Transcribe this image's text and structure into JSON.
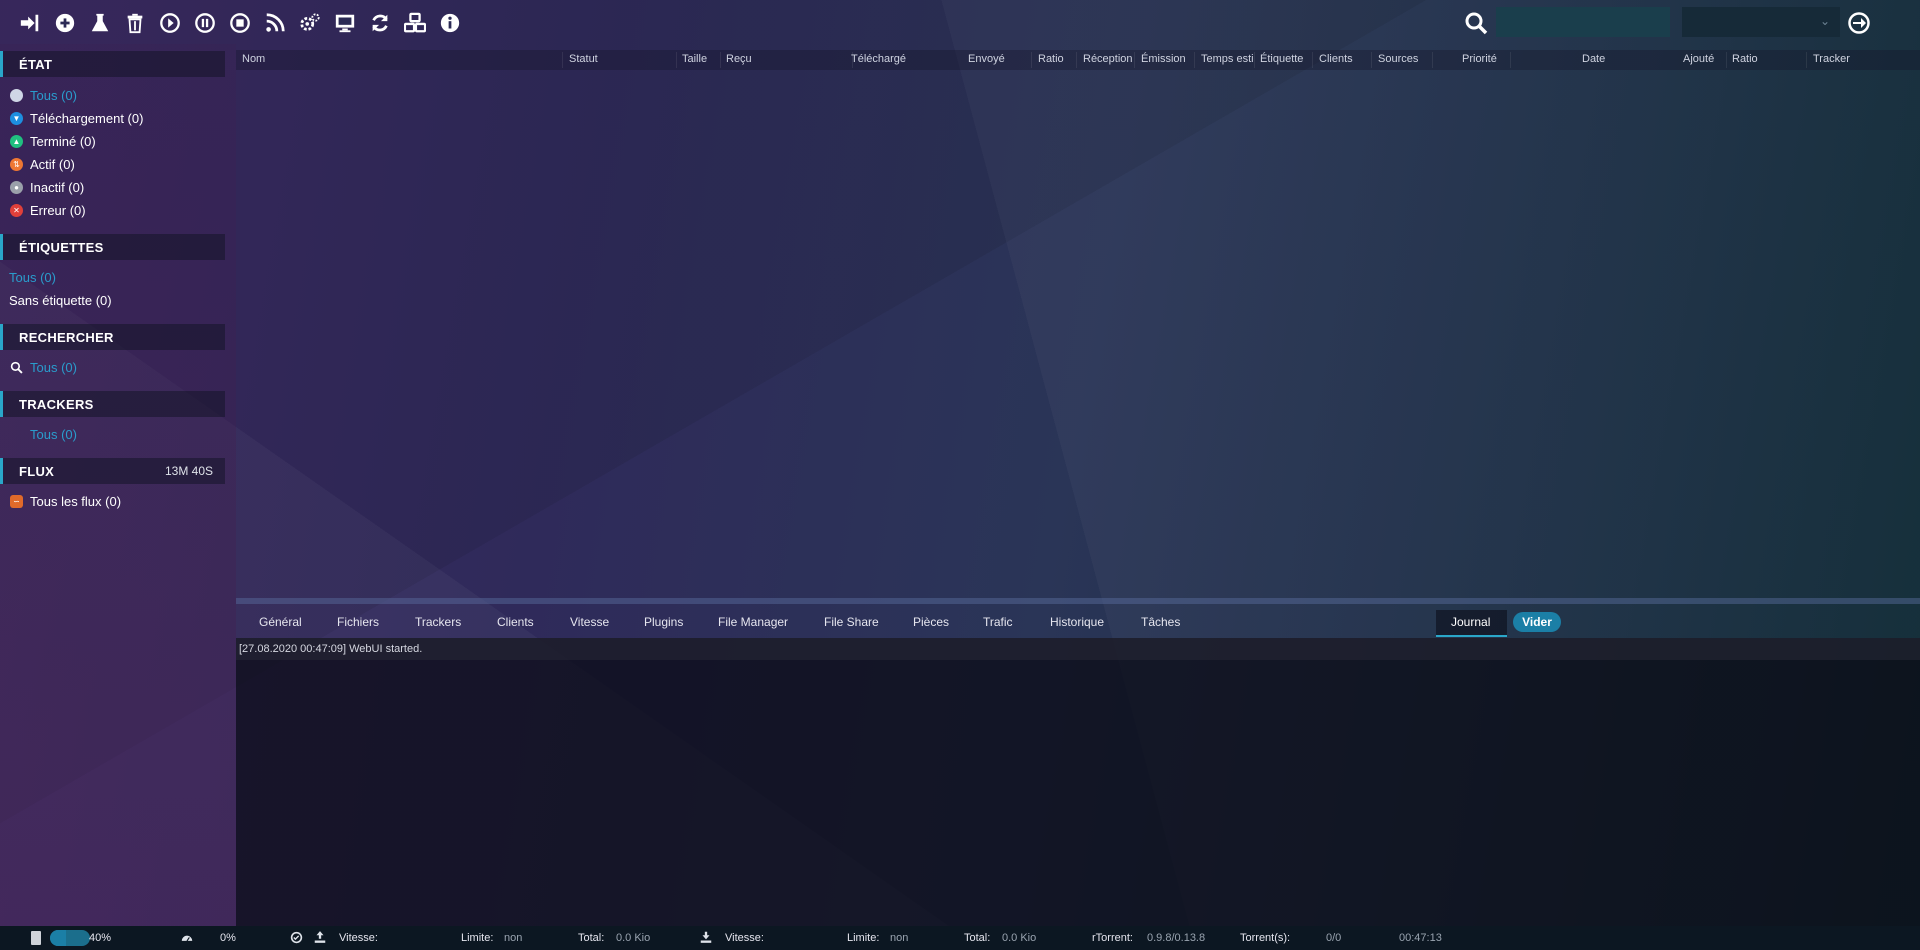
{
  "toolbar": {
    "buttons": [
      "login-icon",
      "add-icon",
      "flask-icon",
      "trash-icon",
      "play-icon",
      "pause-icon",
      "stop-icon",
      "rss-icon",
      "settings-icon",
      "monitor-icon",
      "refresh-icon",
      "plugins-icon",
      "info-icon"
    ],
    "search_placeholder": "",
    "search_select_value": ""
  },
  "sidebar": {
    "state": {
      "title": "ÉTAT",
      "items": [
        {
          "label": "Tous (0)",
          "color": "#cfd6e6"
        },
        {
          "label": "Téléchargement (0)",
          "color": "#1d8fe0"
        },
        {
          "label": "Terminé (0)",
          "color": "#20c080"
        },
        {
          "label": "Actif (0)",
          "color": "#ee7733"
        },
        {
          "label": "Inactif (0)",
          "color": "#9aa0aa"
        },
        {
          "label": "Erreur (0)",
          "color": "#e0403a"
        }
      ]
    },
    "labels": {
      "title": "ÉTIQUETTES",
      "items": [
        "Tous (0)",
        "Sans étiquette (0)"
      ]
    },
    "search": {
      "title": "RECHERCHER",
      "items": [
        "Tous (0)"
      ]
    },
    "trackers": {
      "title": "TRACKERS",
      "items": [
        "Tous (0)"
      ]
    },
    "feeds": {
      "title": "FLUX",
      "timer": "13M 40S",
      "items": [
        "Tous les flux (0)"
      ]
    }
  },
  "table": {
    "columns": [
      "Nom",
      "Statut",
      "Taille",
      "Reçu",
      "Téléchargé",
      "Envoyé",
      "Ratio",
      "Réception",
      "Émission",
      "Temps esti",
      "Étiquette",
      "Clients",
      "Sources",
      "Priorité",
      "Date",
      "Ajouté",
      "Ratio",
      "Tracker"
    ]
  },
  "tabs": {
    "items": [
      "Général",
      "Fichiers",
      "Trackers",
      "Clients",
      "Vitesse",
      "Plugins",
      "File Manager",
      "File Share",
      "Pièces",
      "Trafic",
      "Historique",
      "Tâches",
      "Journal"
    ],
    "active": "Journal",
    "clear_label": "Vider"
  },
  "log": {
    "lines": [
      "[27.08.2020 00:47:09] WebUI started."
    ]
  },
  "status": {
    "disk_percent": 40,
    "disk_label": "40%",
    "cpu_label": "0%",
    "up_speed_label": "Vitesse:",
    "up_speed_value": "",
    "up_limit_label": "Limite:",
    "up_limit_value": "non",
    "up_total_label": "Total:",
    "up_total_value": "0.0 Kio",
    "down_speed_label": "Vitesse:",
    "down_speed_value": "",
    "down_limit_label": "Limite:",
    "down_limit_value": "non",
    "down_total_label": "Total:",
    "down_total_value": "0.0 Kio",
    "rtorrent_label": "rTorrent:",
    "rtorrent_value": "0.9.8/0.13.8",
    "torrents_label": "Torrent(s):",
    "torrents_value": "0/0",
    "time": "00:47:13"
  }
}
